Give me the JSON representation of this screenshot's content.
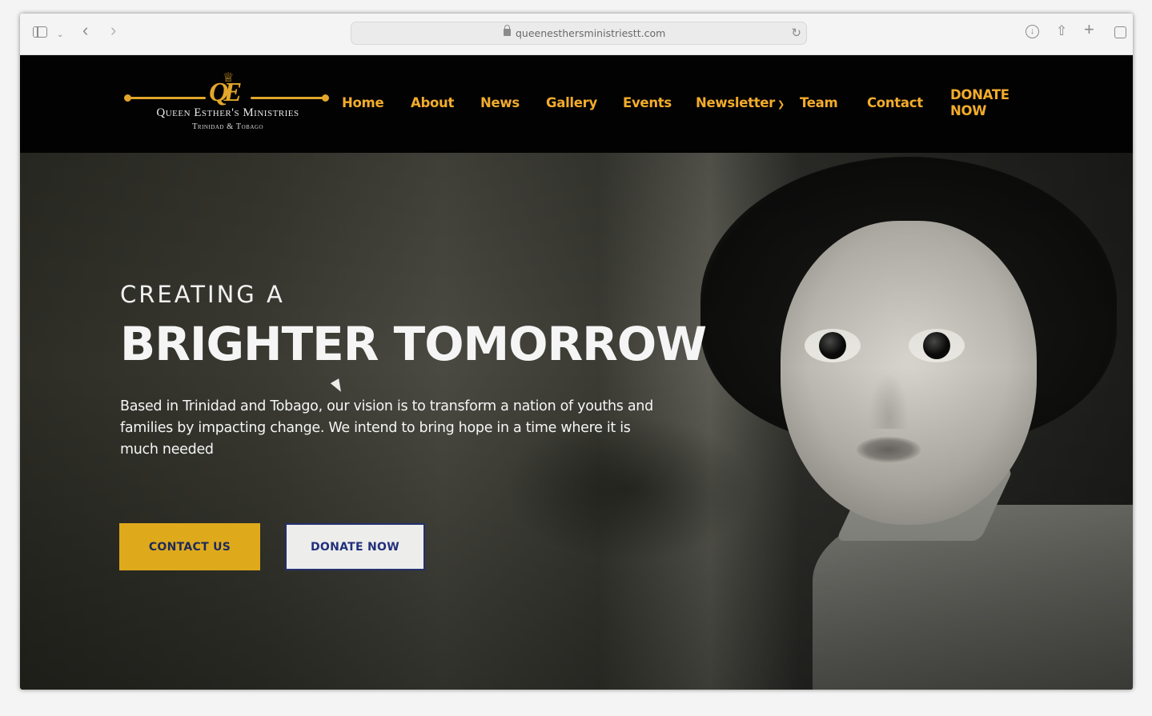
{
  "browser": {
    "url": "queenesthersministriestt.com",
    "icons": [
      "sidebar-icon",
      "chevron-down-icon",
      "back-icon",
      "forward-icon",
      "lock-icon",
      "reload-icon",
      "download-icon",
      "share-icon",
      "new-tab-icon",
      "tabs-icon"
    ]
  },
  "logo": {
    "monogram": "QE",
    "name": "Queen Esther's Ministries",
    "subtitle": "Trinidad & Tobago"
  },
  "nav": {
    "items": [
      "Home",
      "About",
      "News",
      "Gallery",
      "Events",
      "Newsletter",
      "Team",
      "Contact"
    ],
    "donate_line1": "DONATE",
    "donate_line2": "NOW"
  },
  "hero": {
    "kicker": "CREATING A",
    "headline": "BRIGHTER TOMORROW",
    "description": "Based in Trinidad and Tobago, our vision is to transform a nation of youths and families by impacting change. We intend to bring hope in a time where it is much needed",
    "contact_button": "CONTACT US",
    "donate_button": "DONATE NOW"
  },
  "colors": {
    "accent_gold": "#f2ac2c",
    "button_gold": "#deaa1c",
    "navy": "#22307a",
    "header_bg": "#020202"
  }
}
